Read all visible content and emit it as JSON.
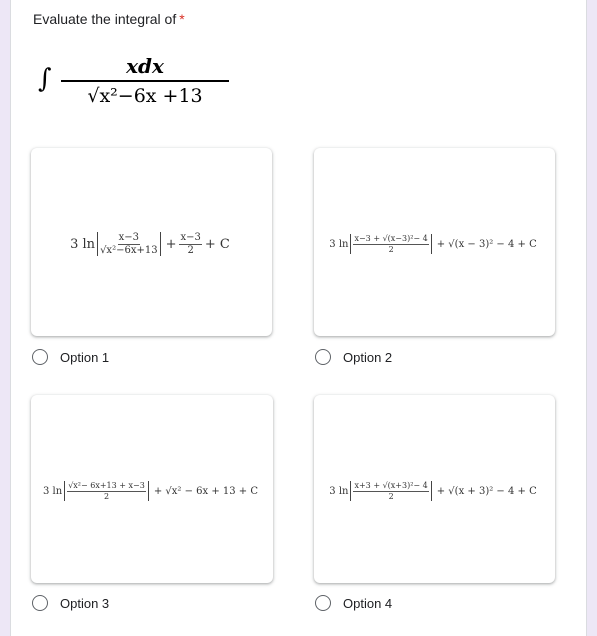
{
  "question": {
    "title": "Evaluate the integral of",
    "required_mark": "*",
    "integral": {
      "sign": "∫",
      "numerator": "xdx",
      "denominator": "√x²−6x +13"
    }
  },
  "options": [
    {
      "label": "Option 1",
      "selected": false,
      "formula": {
        "coef": "3 ln",
        "abs_num": "x−3",
        "abs_den": "√x²−6x+13",
        "tail_op": "+",
        "tail_num": "x−3",
        "tail_den": "2",
        "constant": "+ C"
      }
    },
    {
      "label": "Option 2",
      "selected": false,
      "formula": {
        "coef": "3 ln",
        "abs_num": "x−3 + √(x−3)²− 4",
        "abs_den": "2",
        "tail": "+ √(x − 3)² − 4 + C"
      }
    },
    {
      "label": "Option 3",
      "selected": false,
      "formula": {
        "coef": "3 ln",
        "abs_num": "√x²− 6x+13 + x−3",
        "abs_den": "2",
        "tail": "+ √x² − 6x + 13 + C"
      }
    },
    {
      "label": "Option 4",
      "selected": false,
      "formula": {
        "coef": "3 ln",
        "abs_num": "x+3 + √(x+3)²− 4",
        "abs_den": "2",
        "tail": "+ √(x + 3)² − 4 + C"
      }
    }
  ],
  "colors": {
    "background": "#ede7f6",
    "required": "#d93025",
    "text": "#202124"
  }
}
